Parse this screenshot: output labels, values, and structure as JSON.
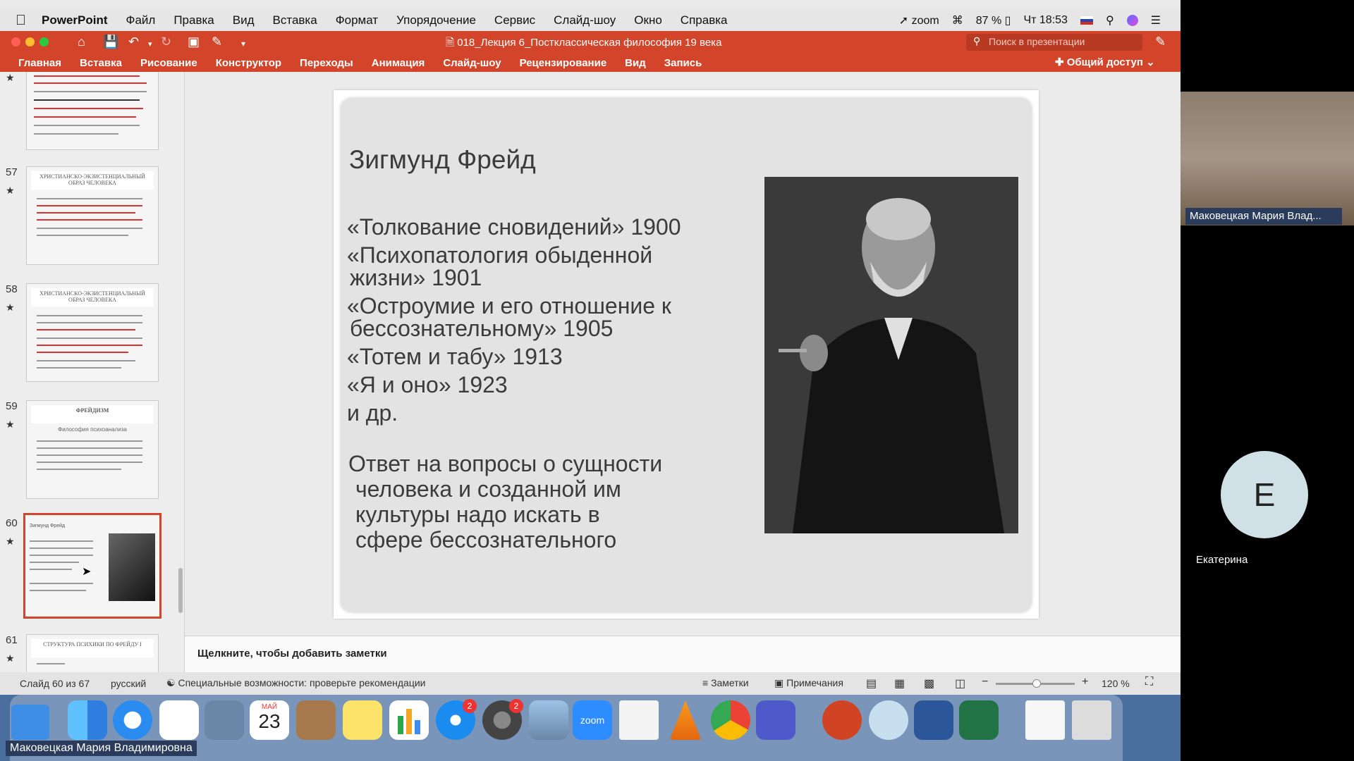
{
  "menubar": {
    "app_name": "PowerPoint",
    "items": [
      "Файл",
      "Правка",
      "Вид",
      "Вставка",
      "Формат",
      "Упорядочение",
      "Сервис",
      "Слайд-шоу",
      "Окно",
      "Справка"
    ],
    "zoom_label": "zoom",
    "battery": "87 %",
    "clock": "Чт 18:53"
  },
  "titlebar": {
    "doc_title": "018_Лекция 6_Постклассическая философия 19 века",
    "search_placeholder": "Поиск в презентации"
  },
  "ribbon": {
    "tabs": [
      "Главная",
      "Вставка",
      "Рисование",
      "Конструктор",
      "Переходы",
      "Анимация",
      "Слайд-шоу",
      "Рецензирование",
      "Вид",
      "Запись"
    ],
    "share_label": "Общий доступ"
  },
  "thumbnails": [
    {
      "num": "57",
      "title": "ХРИСТИАНСКО-ЭКЗИСТЕНЦИАЛЬНЫЙ ОБРАЗ ЧЕЛОВЕКА"
    },
    {
      "num": "58",
      "title": "ХРИСТИАНСКО-ЭКЗИСТЕНЦИАЛЬНЫЙ ОБРАЗ ЧЕЛОВЕКА"
    },
    {
      "num": "59",
      "title": "ФРЕЙДИЗМ",
      "subtitle": "Философия психоанализа"
    },
    {
      "num": "60",
      "title": "Зигмунд Фрейд"
    },
    {
      "num": "61",
      "title": "СТРУКТУРА ПСИХИКИ ПО ФРЕЙДУ I"
    }
  ],
  "slide": {
    "title": "Зигмунд Фрейд",
    "works": [
      "«Толкование сновидений» 1900",
      "«Психопатология обыденной",
      " жизни» 1901",
      "«Остроумие и его отношение к",
      " бессознательному» 1905",
      "«Тотем и табу» 1913",
      "«Я и оно» 1923",
      "и др."
    ],
    "answer_lines": [
      "Ответ на вопросы о сущности",
      " человека и созданной им",
      " культуры надо искать в",
      " сфере бессознательного"
    ]
  },
  "notes_placeholder": "Щелкните, чтобы добавить заметки",
  "statusbar": {
    "slide_counter": "Слайд 60 из 67",
    "language": "русский",
    "accessibility": "Специальные возможности: проверьте рекомендации",
    "notes_label": "Заметки",
    "comments_label": "Примечания",
    "zoom": "120 %"
  },
  "dock": {
    "calendar_month": "МАЙ",
    "calendar_day": "23",
    "appstore_badge": "2",
    "settings_badge": "2",
    "zoom_label": "zoom"
  },
  "participants": {
    "video_name": "Маковецкая Мария Влад...",
    "avatar_letter": "Е",
    "avatar_name": "Екатерина",
    "screen_share_name": "Маковецкая Мария Владимировна"
  }
}
